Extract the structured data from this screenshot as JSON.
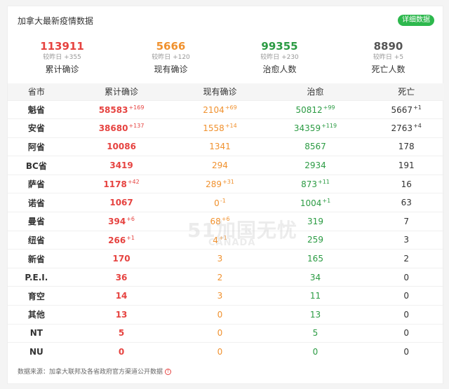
{
  "header": {
    "title": "加拿大最新疫情数据",
    "detail_label": "详细数据"
  },
  "colors": {
    "confirmed": "#e64340",
    "current": "#f0912e",
    "cured": "#2b9b43",
    "dead": "#555555",
    "button": "#2db84d"
  },
  "summary": [
    {
      "num": "113911",
      "delta": "较昨日 +355",
      "label": "累计确诊",
      "color": "#e64340"
    },
    {
      "num": "5666",
      "delta": "较昨日 +120",
      "label": "现有确诊",
      "color": "#f0912e"
    },
    {
      "num": "99355",
      "delta": "较昨日 +230",
      "label": "治愈人数",
      "color": "#2b9b43"
    },
    {
      "num": "8890",
      "delta": "较昨日 +5",
      "label": "死亡人数",
      "color": "#555555"
    }
  ],
  "table": {
    "headers": [
      "省市",
      "累计确诊",
      "现有确诊",
      "治愈",
      "死亡"
    ],
    "rows": [
      {
        "region": "魁省",
        "conf": "58583",
        "conf_inc": "+169",
        "curr": "2104",
        "curr_inc": "+69",
        "cured": "50812",
        "cured_inc": "+99",
        "dead": "5667",
        "dead_inc": "+1"
      },
      {
        "region": "安省",
        "conf": "38680",
        "conf_inc": "+137",
        "curr": "1558",
        "curr_inc": "+14",
        "cured": "34359",
        "cured_inc": "+119",
        "dead": "2763",
        "dead_inc": "+4"
      },
      {
        "region": "阿省",
        "conf": "10086",
        "conf_inc": "",
        "curr": "1341",
        "curr_inc": "",
        "cured": "8567",
        "cured_inc": "",
        "dead": "178",
        "dead_inc": ""
      },
      {
        "region": "BC省",
        "conf": "3419",
        "conf_inc": "",
        "curr": "294",
        "curr_inc": "",
        "cured": "2934",
        "cured_inc": "",
        "dead": "191",
        "dead_inc": ""
      },
      {
        "region": "萨省",
        "conf": "1178",
        "conf_inc": "+42",
        "curr": "289",
        "curr_inc": "+31",
        "cured": "873",
        "cured_inc": "+11",
        "dead": "16",
        "dead_inc": ""
      },
      {
        "region": "诺省",
        "conf": "1067",
        "conf_inc": "",
        "curr": "0",
        "curr_inc": "-1",
        "cured": "1004",
        "cured_inc": "+1",
        "dead": "63",
        "dead_inc": ""
      },
      {
        "region": "曼省",
        "conf": "394",
        "conf_inc": "+6",
        "curr": "68",
        "curr_inc": "+6",
        "cured": "319",
        "cured_inc": "",
        "dead": "7",
        "dead_inc": ""
      },
      {
        "region": "纽省",
        "conf": "266",
        "conf_inc": "+1",
        "curr": "4",
        "curr_inc": "+1",
        "cured": "259",
        "cured_inc": "",
        "dead": "3",
        "dead_inc": ""
      },
      {
        "region": "新省",
        "conf": "170",
        "conf_inc": "",
        "curr": "3",
        "curr_inc": "",
        "cured": "165",
        "cured_inc": "",
        "dead": "2",
        "dead_inc": ""
      },
      {
        "region": "P.E.I.",
        "conf": "36",
        "conf_inc": "",
        "curr": "2",
        "curr_inc": "",
        "cured": "34",
        "cured_inc": "",
        "dead": "0",
        "dead_inc": ""
      },
      {
        "region": "育空",
        "conf": "14",
        "conf_inc": "",
        "curr": "3",
        "curr_inc": "",
        "cured": "11",
        "cured_inc": "",
        "dead": "0",
        "dead_inc": ""
      },
      {
        "region": "其他",
        "conf": "13",
        "conf_inc": "",
        "curr": "0",
        "curr_inc": "",
        "cured": "13",
        "cured_inc": "",
        "dead": "0",
        "dead_inc": ""
      },
      {
        "region": "NT",
        "conf": "5",
        "conf_inc": "",
        "curr": "0",
        "curr_inc": "",
        "cured": "5",
        "cured_inc": "",
        "dead": "0",
        "dead_inc": ""
      },
      {
        "region": "NU",
        "conf": "0",
        "conf_inc": "",
        "curr": "0",
        "curr_inc": "",
        "cured": "0",
        "cured_inc": "",
        "dead": "0",
        "dead_inc": ""
      }
    ]
  },
  "footer": {
    "source": "数据来源：加拿大联邦及各省政府官方渠道公开数据",
    "info_icon": "info-icon",
    "info_glyph": "!"
  },
  "watermark": {
    "main": "51加国无忧",
    "sub": "CANADA"
  }
}
